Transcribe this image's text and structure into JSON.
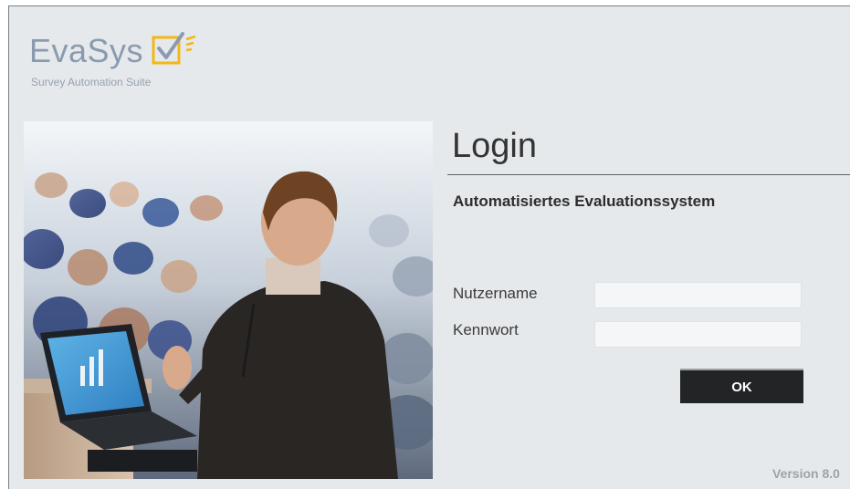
{
  "brand": {
    "name": "EvaSys",
    "tagline": "Survey Automation Suite"
  },
  "login": {
    "title": "Login",
    "subtitle": "Automatisiertes Evaluationssystem",
    "username_label": "Nutzername",
    "username_value": "",
    "password_label": "Kennwort",
    "password_value": "",
    "submit_label": "OK"
  },
  "footer": {
    "version": "Version 8.0"
  },
  "colors": {
    "background": "#e6e9eb",
    "logo_text": "#8a9bb0",
    "logo_check": "#f2b817",
    "button": "#222426"
  },
  "icons": {
    "logo_mark": "checkbox-check-icon"
  }
}
